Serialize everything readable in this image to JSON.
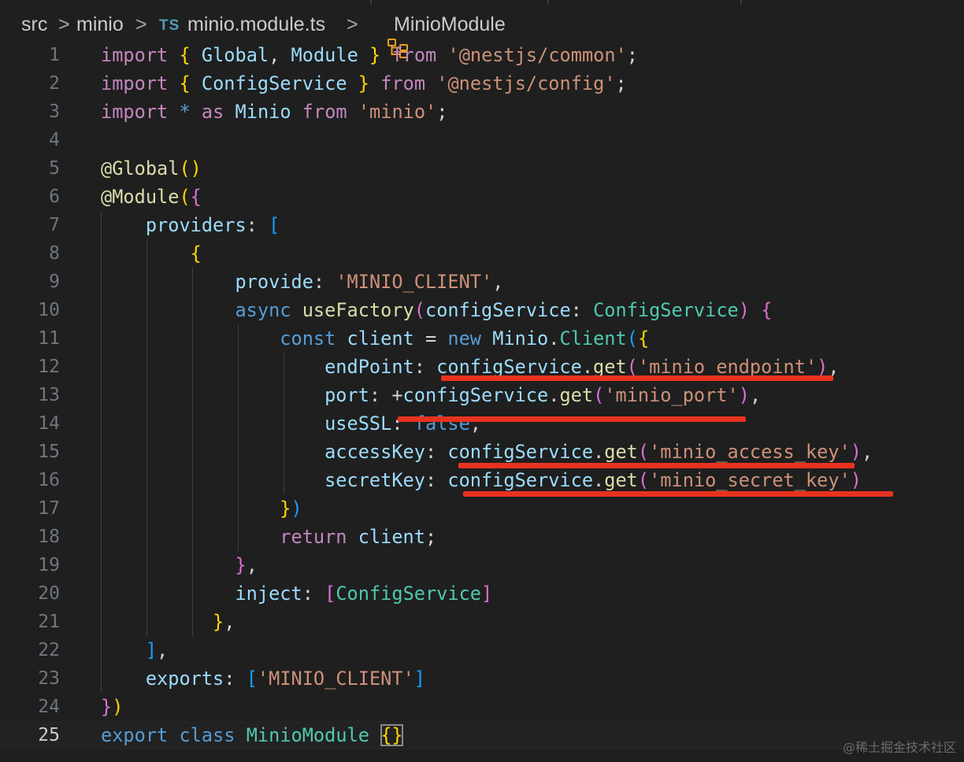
{
  "breadcrumb": {
    "items": [
      "src",
      "minio",
      "minio.module.ts",
      "MinioModule"
    ],
    "separator": ">",
    "file_badge": "TS"
  },
  "code": {
    "current_line": 25,
    "lines": [
      [
        [
          "kw",
          "import"
        ],
        [
          "pu",
          " "
        ],
        [
          "b1",
          "{"
        ],
        [
          "pu",
          " "
        ],
        [
          "id",
          "Global"
        ],
        [
          "pu",
          ", "
        ],
        [
          "id",
          "Module"
        ],
        [
          "pu",
          " "
        ],
        [
          "b1",
          "}"
        ],
        [
          "pu",
          " "
        ],
        [
          "kw",
          "from"
        ],
        [
          "pu",
          " "
        ],
        [
          "st",
          "'@nestjs/common'"
        ],
        [
          "pu",
          ";"
        ]
      ],
      [
        [
          "kw",
          "import"
        ],
        [
          "pu",
          " "
        ],
        [
          "b1",
          "{"
        ],
        [
          "pu",
          " "
        ],
        [
          "id",
          "ConfigService"
        ],
        [
          "pu",
          " "
        ],
        [
          "b1",
          "}"
        ],
        [
          "pu",
          " "
        ],
        [
          "kw",
          "from"
        ],
        [
          "pu",
          " "
        ],
        [
          "st",
          "'@nestjs/config'"
        ],
        [
          "pu",
          ";"
        ]
      ],
      [
        [
          "kw",
          "import"
        ],
        [
          "pu",
          " "
        ],
        [
          "kb",
          "*"
        ],
        [
          "pu",
          " "
        ],
        [
          "kw",
          "as"
        ],
        [
          "pu",
          " "
        ],
        [
          "id",
          "Minio"
        ],
        [
          "pu",
          " "
        ],
        [
          "kw",
          "from"
        ],
        [
          "pu",
          " "
        ],
        [
          "st",
          "'minio'"
        ],
        [
          "pu",
          ";"
        ]
      ],
      [],
      [
        [
          "fn",
          "@Global"
        ],
        [
          "b1",
          "()"
        ]
      ],
      [
        [
          "fn",
          "@Module"
        ],
        [
          "b1",
          "("
        ],
        [
          "b2",
          "{"
        ]
      ],
      [
        [
          "pu",
          "    "
        ],
        [
          "id",
          "providers"
        ],
        [
          "pu",
          ": "
        ],
        [
          "b3",
          "["
        ]
      ],
      [
        [
          "pu",
          "        "
        ],
        [
          "b1",
          "{"
        ]
      ],
      [
        [
          "pu",
          "            "
        ],
        [
          "id",
          "provide"
        ],
        [
          "pu",
          ": "
        ],
        [
          "st",
          "'MINIO_CLIENT'"
        ],
        [
          "pu",
          ","
        ]
      ],
      [
        [
          "pu",
          "            "
        ],
        [
          "kb",
          "async"
        ],
        [
          "pu",
          " "
        ],
        [
          "fn",
          "useFactory"
        ],
        [
          "b2",
          "("
        ],
        [
          "id",
          "configService"
        ],
        [
          "pu",
          ": "
        ],
        [
          "ty",
          "ConfigService"
        ],
        [
          "b2",
          ")"
        ],
        [
          "pu",
          " "
        ],
        [
          "b2",
          "{"
        ]
      ],
      [
        [
          "pu",
          "                "
        ],
        [
          "kb",
          "const"
        ],
        [
          "pu",
          " "
        ],
        [
          "id",
          "client"
        ],
        [
          "pu",
          " = "
        ],
        [
          "kb",
          "new"
        ],
        [
          "pu",
          " "
        ],
        [
          "id",
          "Minio"
        ],
        [
          "pu",
          "."
        ],
        [
          "ty",
          "Client"
        ],
        [
          "b3",
          "("
        ],
        [
          "b1",
          "{"
        ]
      ],
      [
        [
          "pu",
          "                    "
        ],
        [
          "id",
          "endPoint"
        ],
        [
          "pu",
          ": "
        ],
        [
          "id",
          "configService"
        ],
        [
          "pu",
          "."
        ],
        [
          "fn",
          "get"
        ],
        [
          "b2",
          "("
        ],
        [
          "st",
          "'minio_endpoint'"
        ],
        [
          "b2",
          ")"
        ],
        [
          "pu",
          ","
        ]
      ],
      [
        [
          "pu",
          "                    "
        ],
        [
          "id",
          "port"
        ],
        [
          "pu",
          ": +"
        ],
        [
          "id",
          "configService"
        ],
        [
          "pu",
          "."
        ],
        [
          "fn",
          "get"
        ],
        [
          "b2",
          "("
        ],
        [
          "st",
          "'minio_port'"
        ],
        [
          "b2",
          ")"
        ],
        [
          "pu",
          ","
        ]
      ],
      [
        [
          "pu",
          "                    "
        ],
        [
          "id",
          "useSSL"
        ],
        [
          "pu",
          ": "
        ],
        [
          "kb",
          "false"
        ],
        [
          "pu",
          ","
        ]
      ],
      [
        [
          "pu",
          "                    "
        ],
        [
          "id",
          "accessKey"
        ],
        [
          "pu",
          ": "
        ],
        [
          "id",
          "configService"
        ],
        [
          "pu",
          "."
        ],
        [
          "fn",
          "get"
        ],
        [
          "b2",
          "("
        ],
        [
          "st",
          "'minio_access_key'"
        ],
        [
          "b2",
          ")"
        ],
        [
          "pu",
          ","
        ]
      ],
      [
        [
          "pu",
          "                    "
        ],
        [
          "id",
          "secretKey"
        ],
        [
          "pu",
          ": "
        ],
        [
          "id",
          "configService"
        ],
        [
          "pu",
          "."
        ],
        [
          "fn",
          "get"
        ],
        [
          "b2",
          "("
        ],
        [
          "st",
          "'minio_secret_key'"
        ],
        [
          "b2",
          ")"
        ]
      ],
      [
        [
          "pu",
          "                "
        ],
        [
          "b1",
          "}"
        ],
        [
          "b3",
          ")"
        ]
      ],
      [
        [
          "pu",
          "                "
        ],
        [
          "kw",
          "return"
        ],
        [
          "pu",
          " "
        ],
        [
          "id",
          "client"
        ],
        [
          "pu",
          ";"
        ]
      ],
      [
        [
          "pu",
          "            "
        ],
        [
          "b2",
          "}"
        ],
        [
          "pu",
          ","
        ]
      ],
      [
        [
          "pu",
          "            "
        ],
        [
          "id",
          "inject"
        ],
        [
          "pu",
          ": "
        ],
        [
          "b2",
          "["
        ],
        [
          "ty",
          "ConfigService"
        ],
        [
          "b2",
          "]"
        ]
      ],
      [
        [
          "pu",
          "          "
        ],
        [
          "b1",
          "}"
        ],
        [
          "pu",
          ","
        ]
      ],
      [
        [
          "pu",
          "    "
        ],
        [
          "b3",
          "]"
        ],
        [
          "pu",
          ","
        ]
      ],
      [
        [
          "pu",
          "    "
        ],
        [
          "id",
          "exports"
        ],
        [
          "pu",
          ": "
        ],
        [
          "b3",
          "["
        ],
        [
          "st",
          "'MINIO_CLIENT'"
        ],
        [
          "b3",
          "]"
        ]
      ],
      [
        [
          "b2",
          "}"
        ],
        [
          "b1",
          ")"
        ]
      ],
      [
        [
          "kb",
          "export"
        ],
        [
          "pu",
          " "
        ],
        [
          "kb",
          "class"
        ],
        [
          "pu",
          " "
        ],
        [
          "ty",
          "MinioModule"
        ],
        [
          "pu",
          " "
        ],
        [
          "b1",
          "{}"
        ]
      ]
    ]
  },
  "watermark": "@稀土掘金技术社区"
}
